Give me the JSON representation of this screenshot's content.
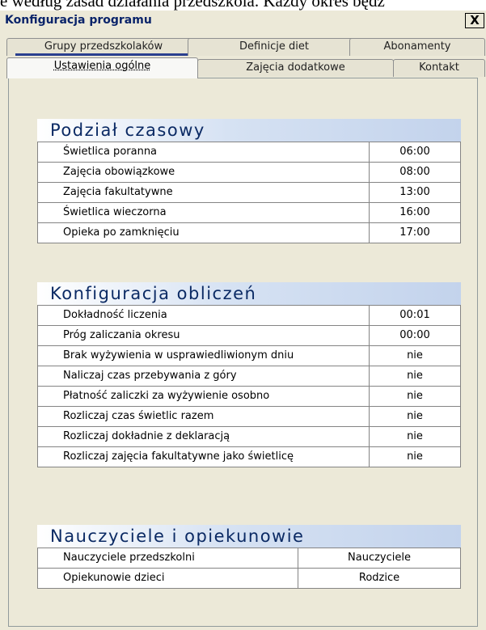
{
  "background_text": "e według zasad działania przedszkola. Każdy okres będz",
  "window": {
    "title": "Konfiguracja programu",
    "close_label": "X"
  },
  "tabs_back": [
    {
      "label": "Grupy przedszkolaków"
    },
    {
      "label": "Definicje diet"
    },
    {
      "label": "Abonamenty"
    }
  ],
  "tabs_front": [
    {
      "label": "Ustawienia ogólne",
      "selected": true
    },
    {
      "label": "Zajęcia dodatkowe"
    },
    {
      "label": "Kontakt"
    }
  ],
  "sections": [
    {
      "title": "Podział czasowy",
      "rows": [
        {
          "label": "Świetlica poranna",
          "value": "06:00"
        },
        {
          "label": "Zajęcia obowiązkowe",
          "value": "08:00"
        },
        {
          "label": "Zajęcia fakultatywne",
          "value": "13:00"
        },
        {
          "label": "Świetlica wieczorna",
          "value": "16:00"
        },
        {
          "label": "Opieka po zamknięciu",
          "value": "17:00"
        }
      ]
    },
    {
      "title": "Konfiguracja obliczeń",
      "rows": [
        {
          "label": "Dokładność liczenia",
          "value": "00:01"
        },
        {
          "label": "Próg zaliczania okresu",
          "value": "00:00"
        },
        {
          "label": "Brak wyżywienia w usprawiedliwionym dniu",
          "value": "nie"
        },
        {
          "label": "Naliczaj czas przebywania z góry",
          "value": "nie"
        },
        {
          "label": "Płatność zaliczki za wyżywienie osobno",
          "value": "nie"
        },
        {
          "label": "Rozliczaj czas świetlic razem",
          "value": "nie"
        },
        {
          "label": "Rozliczaj dokładnie z deklaracją",
          "value": "nie"
        },
        {
          "label": "Rozliczaj zajęcia fakultatywne jako świetlicę",
          "value": "nie"
        }
      ]
    },
    {
      "title": "Nauczyciele i opiekunowie",
      "rows": [
        {
          "label": "Nauczyciele przedszkolni",
          "value": "Nauczyciele"
        },
        {
          "label": "Opiekunowie dzieci",
          "value": "Rodzice"
        }
      ]
    }
  ],
  "colors": {
    "title_text": "#0a246a",
    "section_title": "#0b2a64",
    "window_bg": "#ece9d8"
  }
}
